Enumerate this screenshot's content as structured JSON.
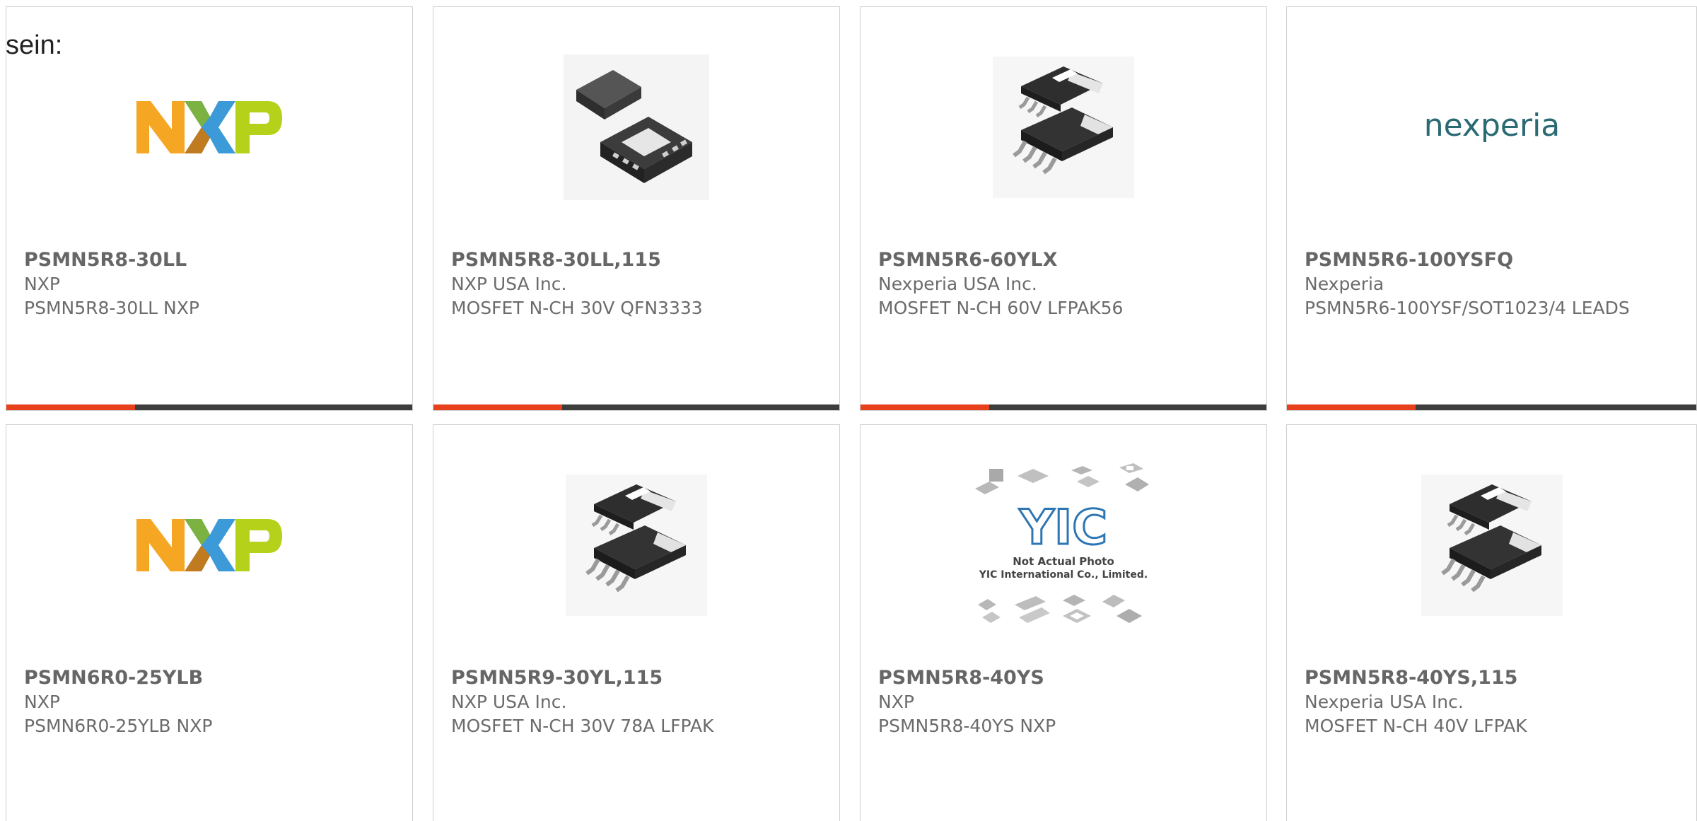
{
  "intro_text": "sein:",
  "icons": {
    "nxp": "nxp-logo-icon",
    "qfn": "qfn-package-icon",
    "lfpak": "lfpak-package-icon",
    "nexperia": "nexperia-logo-icon",
    "yic": "yic-placeholder-icon"
  },
  "nexperia_logo_text": "nexperia",
  "yic": {
    "logo": "YIC",
    "note_line1": "Not Actual Photo",
    "note_line2": "YIC International Co., Limited."
  },
  "colors": {
    "accent": "#e8401c",
    "bar": "#3d3d3d"
  },
  "cards": [
    {
      "part": "PSMN5R8-30LL",
      "maker": "NXP",
      "desc": "PSMN5R8-30LL NXP"
    },
    {
      "part": "PSMN5R8-30LL,115",
      "maker": "NXP USA Inc.",
      "desc": "MOSFET N-CH 30V QFN3333"
    },
    {
      "part": "PSMN5R6-60YLX",
      "maker": "Nexperia USA Inc.",
      "desc": "MOSFET N-CH 60V LFPAK56"
    },
    {
      "part": "PSMN5R6-100YSFQ",
      "maker": "Nexperia",
      "desc": "PSMN5R6-100YSF/SOT1023/4 LEADS"
    },
    {
      "part": "PSMN6R0-25YLB",
      "maker": "NXP",
      "desc": "PSMN6R0-25YLB NXP"
    },
    {
      "part": "PSMN5R9-30YL,115",
      "maker": "NXP USA Inc.",
      "desc": "MOSFET N-CH 30V 78A LFPAK"
    },
    {
      "part": "PSMN5R8-40YS",
      "maker": "NXP",
      "desc": "PSMN5R8-40YS NXP"
    },
    {
      "part": "PSMN5R8-40YS,115",
      "maker": "Nexperia USA Inc.",
      "desc": "MOSFET N-CH 40V LFPAK"
    }
  ]
}
